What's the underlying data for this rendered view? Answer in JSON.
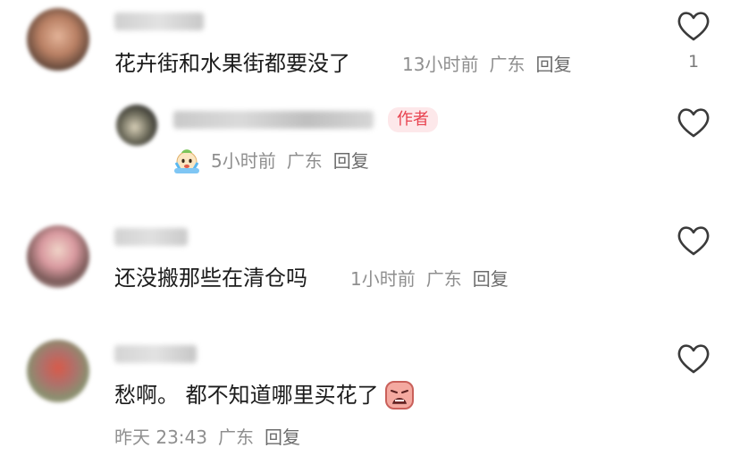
{
  "comments": [
    {
      "text": "花卉街和水果街都要没了",
      "time": "13小时前",
      "location": "广东",
      "reply": "回复",
      "likes": "1"
    },
    {
      "time": "5小时前",
      "location": "广东",
      "reply": "回复",
      "badge": "作者"
    },
    {
      "text": "还没搬那些在清仓吗",
      "time": "1小时前",
      "location": "广东",
      "reply": "回复"
    },
    {
      "text": "愁啊。 都不知道哪里买花了",
      "time": "昨天 23:43",
      "location": "广东",
      "reply": "回复"
    }
  ],
  "icons": {
    "like": "heart-outline-icon",
    "crying_emoji": "crying-emoji-icon",
    "sad_emoji": "sad-face-emoji-icon"
  },
  "colors": {
    "author_badge_bg": "#fde8ea",
    "author_badge_text": "#e8424f",
    "meta": "#8f8f8f"
  }
}
